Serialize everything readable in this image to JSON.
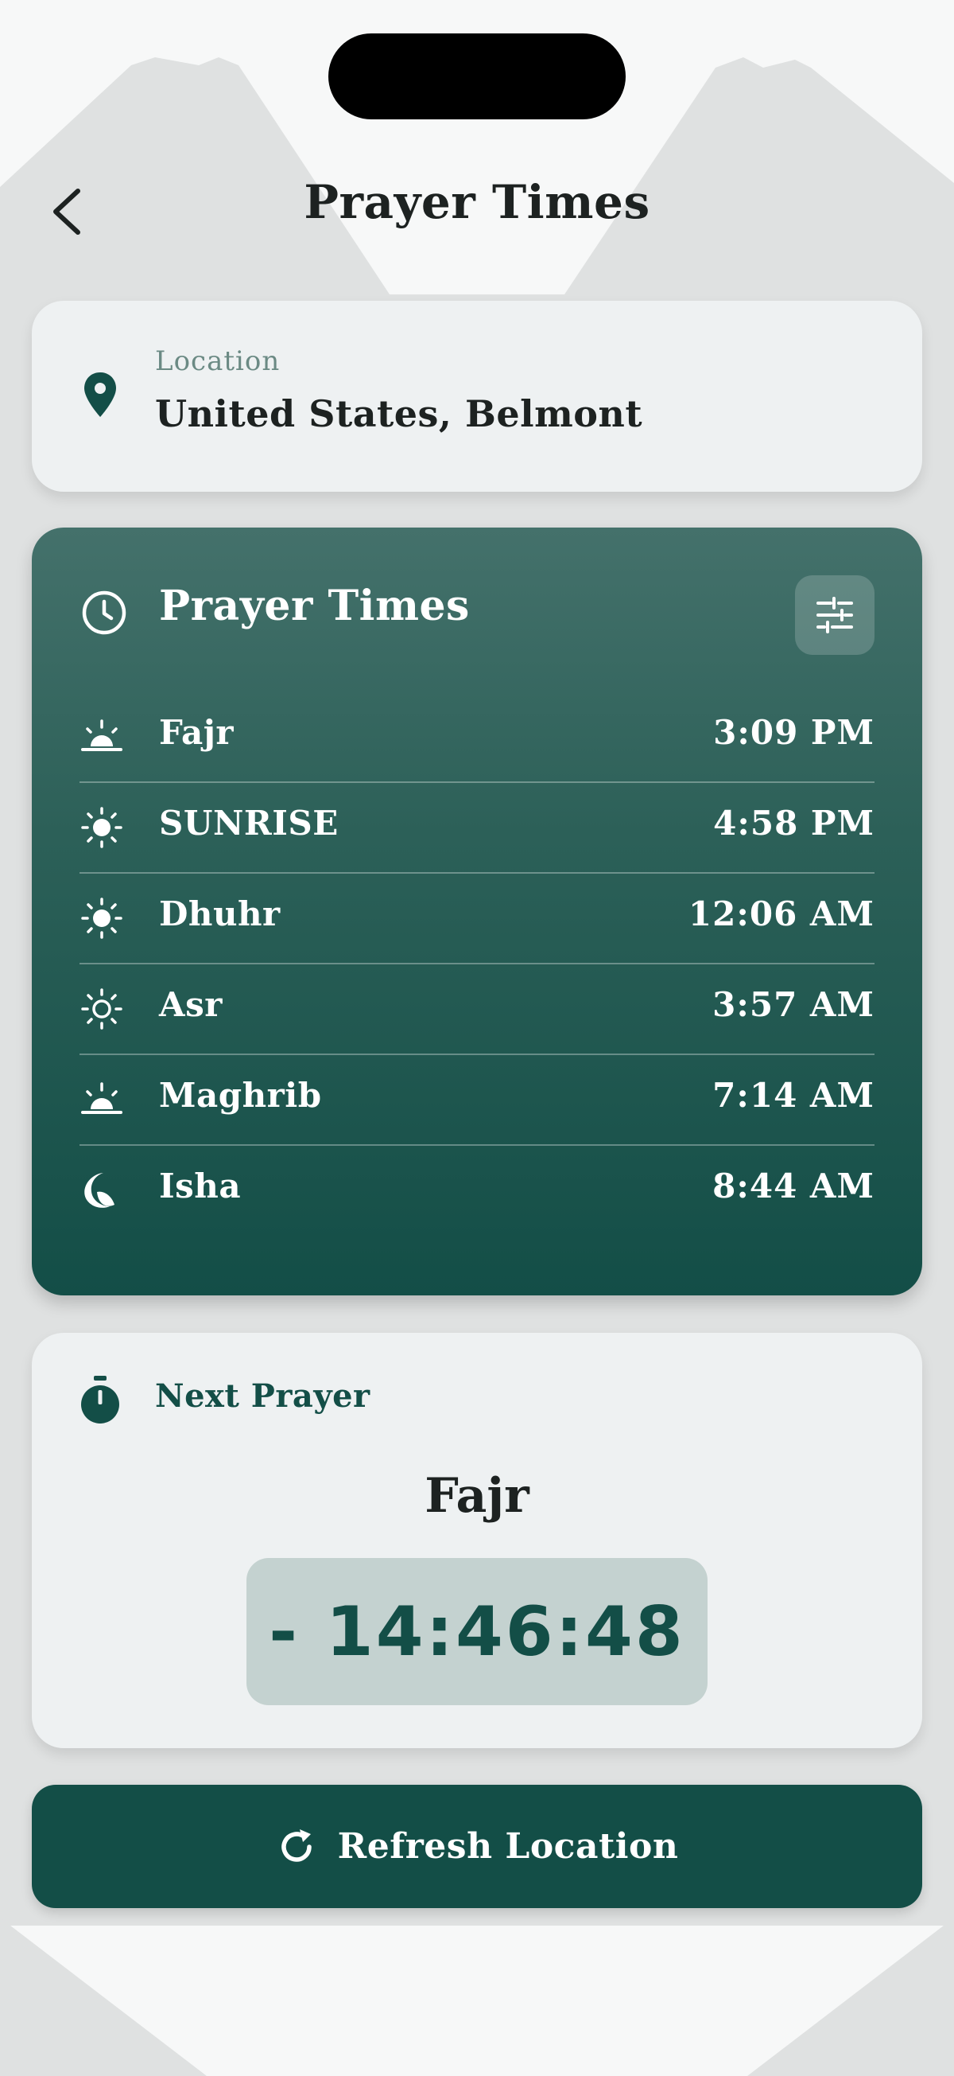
{
  "header": {
    "title": "Prayer Times"
  },
  "location": {
    "label": "Location",
    "value": "United States, Belmont"
  },
  "prayer_times_card": {
    "title": "Prayer Times",
    "prayers": [
      {
        "name": "Fajr",
        "time": "3:09 PM",
        "icon": "sunrise-horizon-icon"
      },
      {
        "name": "SUNRISE",
        "time": "4:58 PM",
        "icon": "sun-icon"
      },
      {
        "name": "Dhuhr",
        "time": "12:06 AM",
        "icon": "sun-icon"
      },
      {
        "name": "Asr",
        "time": "3:57 AM",
        "icon": "sun-outline-icon"
      },
      {
        "name": "Maghrib",
        "time": "7:14 AM",
        "icon": "sunset-horizon-icon"
      },
      {
        "name": "Isha",
        "time": "8:44 AM",
        "icon": "moon-icon"
      }
    ]
  },
  "next_prayer": {
    "label": "Next Prayer",
    "prayer": "Fajr",
    "countdown": "- 14:46:48"
  },
  "refresh_button": {
    "label": "Refresh Location"
  },
  "colors": {
    "brand": "#134e47",
    "card_bg": "#eef1f2",
    "countdown_bg": "#c4d2d0",
    "muted_label": "#6b8a84"
  }
}
